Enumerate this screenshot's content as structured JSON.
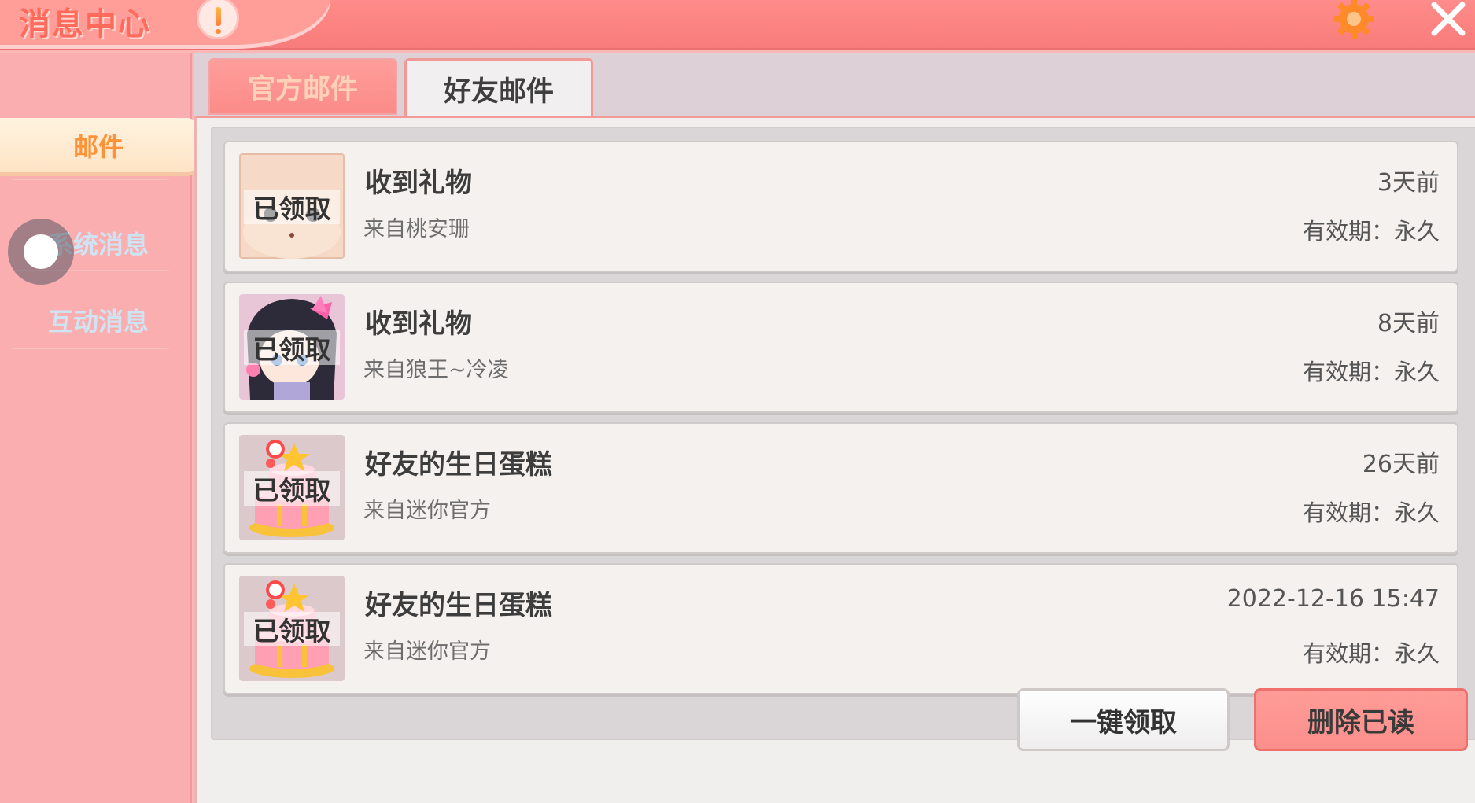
{
  "window": {
    "title": "消息中心",
    "alert_icon": "exclamation-icon",
    "settings_icon": "gear-icon",
    "close_icon": "close-icon",
    "accent_color": "#f87c7b"
  },
  "sidebar": {
    "items": [
      {
        "label": "邮件",
        "active": true
      },
      {
        "label": "系统消息",
        "active": false
      },
      {
        "label": "互动消息",
        "active": false
      }
    ]
  },
  "tabs": [
    {
      "label": "官方邮件",
      "active": false
    },
    {
      "label": "好友邮件",
      "active": true
    }
  ],
  "mails": [
    {
      "title": "收到礼物",
      "sender": "来自桃安珊",
      "time": "3天前",
      "expiry": "有效期：永久",
      "status": "已领取",
      "thumb_icon": "avatar-face-icon"
    },
    {
      "title": "收到礼物",
      "sender": "来自狼王~冷凌",
      "time": "8天前",
      "expiry": "有效期：永久",
      "status": "已领取",
      "thumb_icon": "avatar-girl-icon"
    },
    {
      "title": "好友的生日蛋糕",
      "sender": "来自迷你官方",
      "time": "26天前",
      "expiry": "有效期：永久",
      "status": "已领取",
      "thumb_icon": "birthday-cake-icon"
    },
    {
      "title": "好友的生日蛋糕",
      "sender": "来自迷你官方",
      "time": "2022-12-16 15:47",
      "expiry": "有效期：永久",
      "status": "已领取",
      "thumb_icon": "birthday-cake-icon"
    }
  ],
  "actions": {
    "claim_all": "一键领取",
    "delete_read": "删除已读"
  }
}
